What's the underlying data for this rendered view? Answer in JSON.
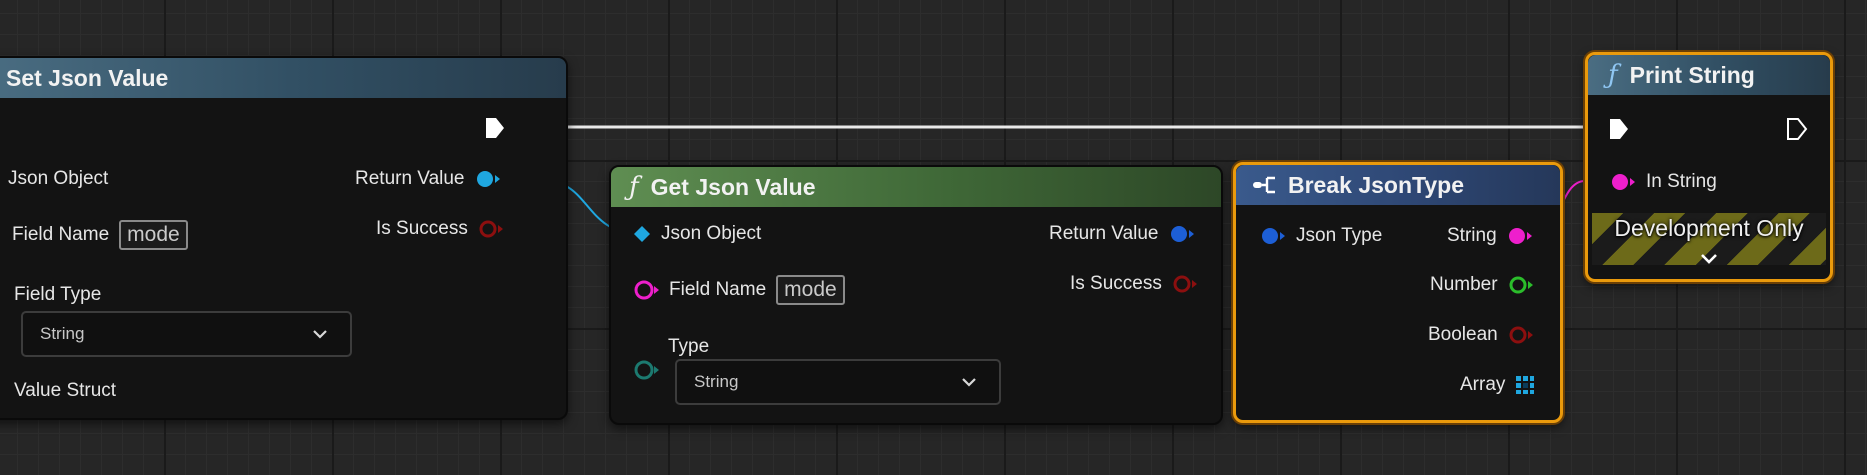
{
  "nodes": {
    "set_json_value": {
      "title": "Set Json Value",
      "inputs": {
        "json_object": "Json Object",
        "field_name": "Field Name",
        "field_name_default": "mode",
        "field_type": "Field Type",
        "field_type_value": "String",
        "value_struct": "Value Struct"
      },
      "outputs": {
        "return_value": "Return Value",
        "is_success": "Is Success"
      }
    },
    "get_json_value": {
      "title": "Get Json Value",
      "inputs": {
        "json_object": "Json Object",
        "field_name": "Field Name",
        "field_name_default": "mode",
        "type": "Type",
        "type_value": "String"
      },
      "outputs": {
        "return_value": "Return Value",
        "is_success": "Is Success"
      }
    },
    "break_json_type": {
      "title": "Break JsonType",
      "inputs": {
        "json_type": "Json Type"
      },
      "outputs": {
        "string": "String",
        "number": "Number",
        "boolean": "Boolean",
        "array": "Array"
      }
    },
    "print_string": {
      "title": "Print String",
      "inputs": {
        "in_string": "In String"
      },
      "development_only": "Development Only"
    }
  },
  "colors": {
    "exec": "#ffffff",
    "json_object_pin": "#1fa7e0",
    "json_type_pin": "#1d5fd6",
    "string_pin": "#ee1fcc",
    "number_pin": "#2bbd2b",
    "boolean_pin": "#8c0f0f",
    "struct_pin": "#1c7a70",
    "selection": "#ea9a0c"
  },
  "icons": [
    "function-icon",
    "break-struct-icon",
    "exec-pin-icon",
    "chevron-down-icon",
    "array-grid-icon"
  ]
}
